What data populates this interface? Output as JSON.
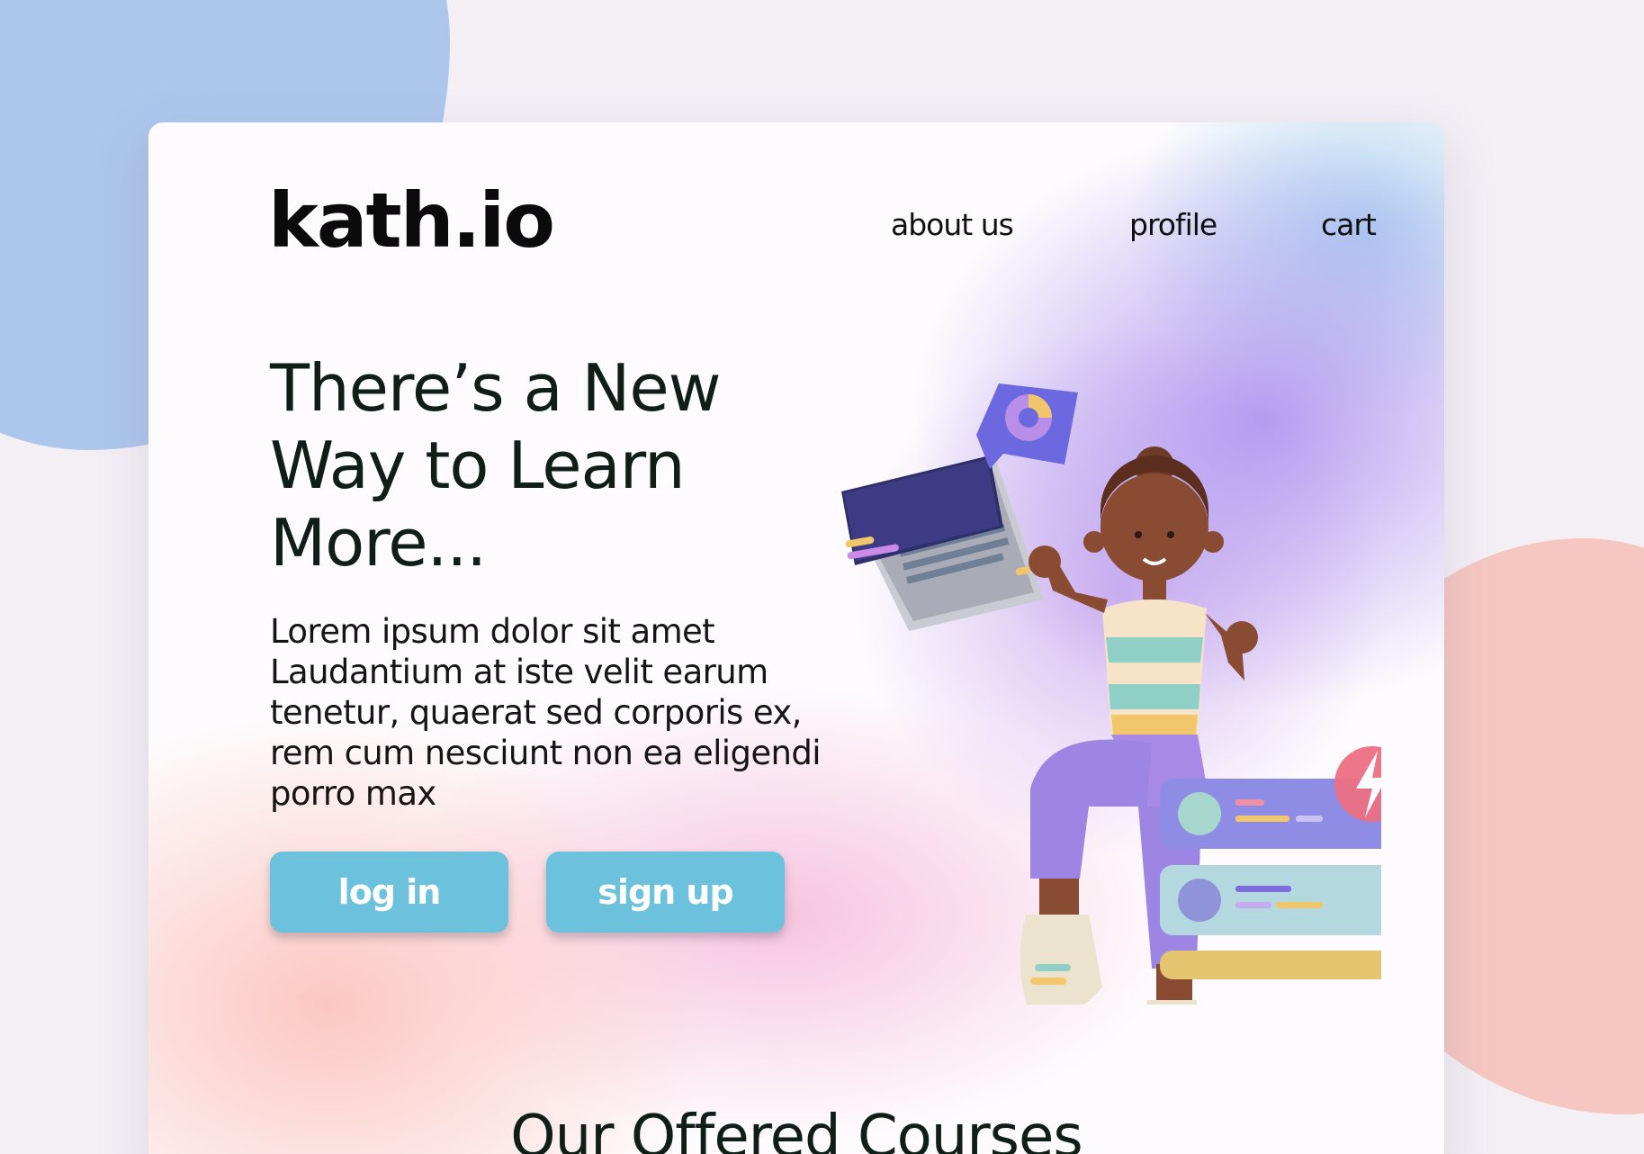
{
  "site": {
    "logo": "kath.io"
  },
  "nav": {
    "items": [
      {
        "label": "about us"
      },
      {
        "label": "profile"
      },
      {
        "label": "cart"
      }
    ]
  },
  "hero": {
    "headline": "There’s a New Way to Learn More...",
    "description": "Lorem ipsum dolor sit amet Laudantium at iste velit earum tenetur, quaerat sed corporis ex, rem cum nesciunt non ea eligendi porro max",
    "buttons": {
      "login_label": "log in",
      "signup_label": "sign up"
    },
    "illustration": {
      "icons": [
        "laptop-icon",
        "chart-bubble-icon",
        "lightning-icon",
        "course-card-icon"
      ]
    }
  },
  "courses": {
    "title": "Our Offered Courses"
  },
  "colors": {
    "button": "#6cc1dd",
    "blob_blue": "#adc6ec",
    "blob_pink": "#f5c7c0",
    "text_dark": "#0f1e17"
  }
}
